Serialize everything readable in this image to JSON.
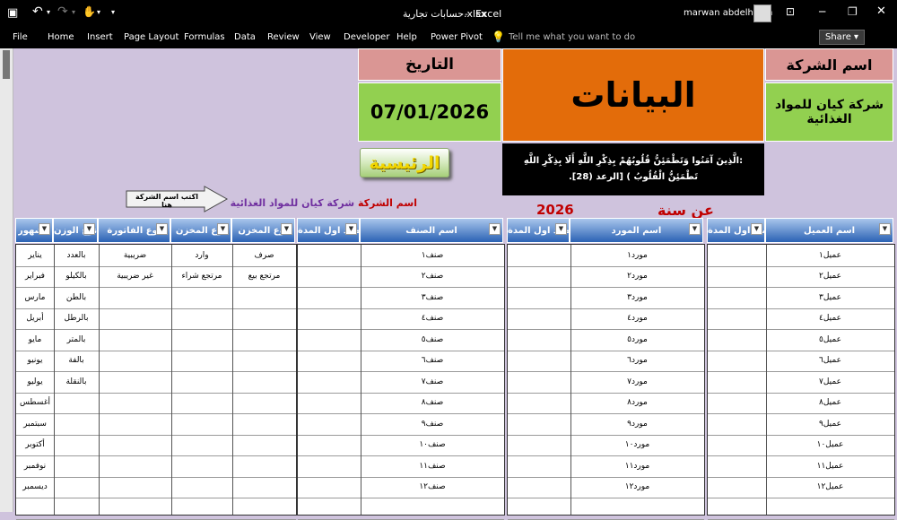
{
  "titlebar": {
    "filename": "حسابات تجارية.xlsx",
    "separator": "-",
    "app": "Excel",
    "user": "marwan abdelhalim"
  },
  "ribbon": {
    "menus": [
      "File",
      "Home",
      "Insert",
      "Page Layout",
      "Formulas",
      "Data",
      "Review",
      "View",
      "Developer",
      "Help",
      "Power Pivot"
    ],
    "tell_me": "Tell me what you want to do",
    "share": "Share"
  },
  "header": {
    "company_label": "اسم الشركة",
    "company_name": "شركة كيان للمواد الغذائية",
    "title": "البيانات",
    "date_label": "التاريخ",
    "date_value": "07/01/2026",
    "home_button": "الرئيسية",
    "verse": ":الَّذِينَ آمَنُوا وَتَطْمَئِنُّ قُلُوبُهُمْ بِذِكْرِ اللَّهِ أَلَا بِذِكْرِ اللَّهِ تَطْمَئِنُّ الْقُلُوبُ ) [الرعد (28].",
    "arrow_text": "اكتب اسم الشركة هنا",
    "company_label2": "اسم الشركة",
    "company_name2": "شركة كيان للمواد الغذائية",
    "year_value": "2026",
    "year_label": "عن سنة"
  },
  "colors": {
    "title_orange": "#e36c0a",
    "green": "#92d050",
    "pink": "#da9694",
    "dark_red": "#c00000",
    "purple": "#7030a0",
    "header_blue": "#2b62b4"
  },
  "tables": {
    "months": {
      "headers": [
        "الشهور",
        "نوع الوزن",
        "نوع الفاتورة",
        "نوع المخزن",
        "نوع المخزن"
      ],
      "rows": [
        [
          "يناير",
          "بالعدد",
          "ضريبية",
          "وارد",
          "صرف"
        ],
        [
          "فبراير",
          "بالكيلو",
          "غير ضريبية",
          "مرتجع شراء",
          "مرتجع بيع"
        ],
        [
          "مارس",
          "بالطن",
          "",
          "",
          ""
        ],
        [
          "أبريل",
          "بالرطل",
          "",
          "",
          ""
        ],
        [
          "مايو",
          "بالمتر",
          "",
          "",
          ""
        ],
        [
          "يونيو",
          "بالفة",
          "",
          "",
          ""
        ],
        [
          "يوليو",
          "بالنقلة",
          "",
          "",
          ""
        ],
        [
          "أغسطس",
          "",
          "",
          "",
          ""
        ],
        [
          "سبتمبر",
          "",
          "",
          "",
          ""
        ],
        [
          "أكتوبر",
          "",
          "",
          "",
          ""
        ],
        [
          "نوفمبر",
          "",
          "",
          "",
          ""
        ],
        [
          "ديسمبر",
          "",
          "",
          "",
          ""
        ]
      ]
    },
    "items": {
      "headers": [
        "رصيد اول المدة",
        "اسم الصنف"
      ],
      "rows": [
        "صنف١",
        "صنف٢",
        "صنف٣",
        "صنف٤",
        "صنف٥",
        "صنف٦",
        "صنف٧",
        "صنف٨",
        "صنف٩",
        "صنف١٠",
        "صنف١١",
        "صنف١٢"
      ]
    },
    "suppliers": {
      "headers": [
        "رصيد اول المدة",
        "اسم المورد"
      ],
      "rows": [
        "مورد١",
        "مورد٢",
        "مورد٣",
        "مورد٤",
        "مورد٥",
        "مورد٦",
        "مورد٧",
        "مورد٨",
        "مورد٩",
        "مورد١٠",
        "مورد١١",
        "مورد١٢"
      ]
    },
    "clients": {
      "headers": [
        "رصيد اول المدة",
        "اسم العميل"
      ],
      "rows": [
        "عميل١",
        "عميل٢",
        "عميل٣",
        "عميل٤",
        "عميل٥",
        "عميل٦",
        "عميل٧",
        "عميل٨",
        "عميل٩",
        "عميل١٠",
        "عميل١١",
        "عميل١٢"
      ]
    }
  }
}
